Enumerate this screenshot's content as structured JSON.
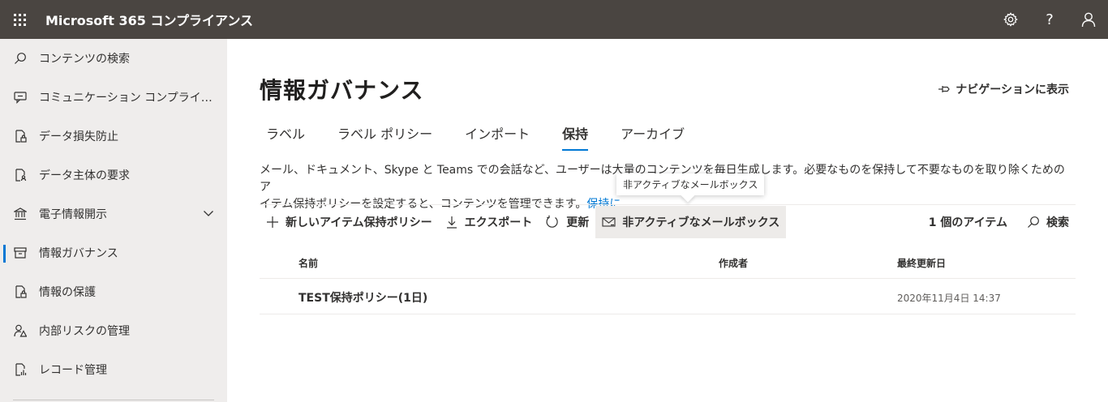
{
  "header": {
    "app_title": "Microsoft 365 コンプライアンス",
    "icons": [
      "waffle-icon",
      "gear-icon",
      "help-icon",
      "person-icon"
    ],
    "help_glyph": "?"
  },
  "sidebar": {
    "items": [
      {
        "label": "コンテンツの検索",
        "icon": "search-icon"
      },
      {
        "label": "コミュニケーション コンプライアンス",
        "icon": "chat-icon"
      },
      {
        "label": "データ損失防止",
        "icon": "dlp-icon"
      },
      {
        "label": "データ主体の要求",
        "icon": "document-person-icon"
      },
      {
        "label": "電子情報開示",
        "icon": "bank-icon"
      },
      {
        "label": "情報ガバナンス",
        "icon": "archive-icon"
      },
      {
        "label": "情報の保護",
        "icon": "lock-document-icon"
      },
      {
        "label": "内部リスクの管理",
        "icon": "person-warning-icon"
      },
      {
        "label": "レコード管理",
        "icon": "chart-document-icon"
      }
    ],
    "active_index": 5,
    "accent": "#0078d4"
  },
  "main": {
    "page_title": "情報ガバナンス",
    "nav_pin_label": "ナビゲーションに表示",
    "tabs": [
      {
        "label": "ラベル"
      },
      {
        "label": "ラベル ポリシー"
      },
      {
        "label": "インポート"
      },
      {
        "label": "保持"
      },
      {
        "label": "アーカイブ"
      }
    ],
    "active_tab": "保持",
    "description_line1": "メール、ドキュメント、Skype と Teams での会話など、ユーザーは大量のコンテンツを毎日生成します。必要なものを保持して不要なものを取り除くためのア",
    "description_line2": "イテム保持ポリシーを設定すると、コンテンツを管理できます。",
    "description_link": "保持に",
    "tooltip": "非アクティブなメールボックス",
    "commands": {
      "new_policy": "新しいアイテム保持ポリシー",
      "export": "エクスポート",
      "refresh": "更新",
      "inactive_mailboxes": "非アクティブなメールボックス",
      "item_count": "1 個のアイテム",
      "search": "検索"
    },
    "table": {
      "columns": [
        "名前",
        "作成者",
        "最終更新日"
      ],
      "rows": [
        {
          "name": "TEST保持ポリシー(1日)",
          "created_by": "",
          "modified": "2020年11月4日 14:37"
        }
      ]
    }
  }
}
